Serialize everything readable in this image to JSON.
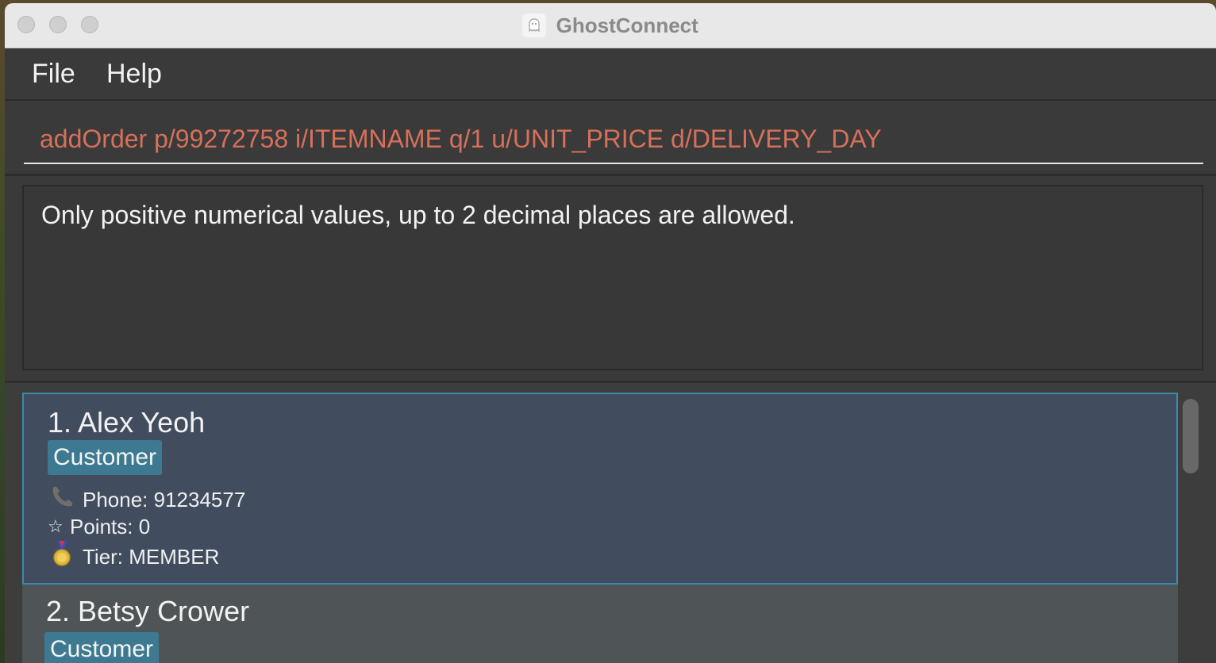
{
  "window": {
    "title": "GhostConnect"
  },
  "menu": {
    "file": "File",
    "help": "Help"
  },
  "command": {
    "text": "addOrder p/99272758 i/ITEMNAME q/1 u/UNIT_PRICE d/DELIVERY_DAY"
  },
  "result": {
    "text": "Only positive numerical values, up to 2 decimal places are allowed."
  },
  "customers": [
    {
      "name": "1. Alex Yeoh",
      "tag": "Customer",
      "phone": "Phone: 91234577",
      "points": "Points: 0",
      "tier": "Tier: MEMBER",
      "selected": true
    },
    {
      "name": "2. Betsy Crower",
      "tag": "Customer",
      "selected": false
    }
  ],
  "icons": {
    "phone": "phone-icon",
    "points": "star-icon",
    "tier": "medal-icon",
    "app": "ghost-icon"
  },
  "colors": {
    "command_text": "#d6705a",
    "selected_card": "#414d5f",
    "selected_border": "#3b8aa8",
    "tag": "#3d7a91"
  }
}
